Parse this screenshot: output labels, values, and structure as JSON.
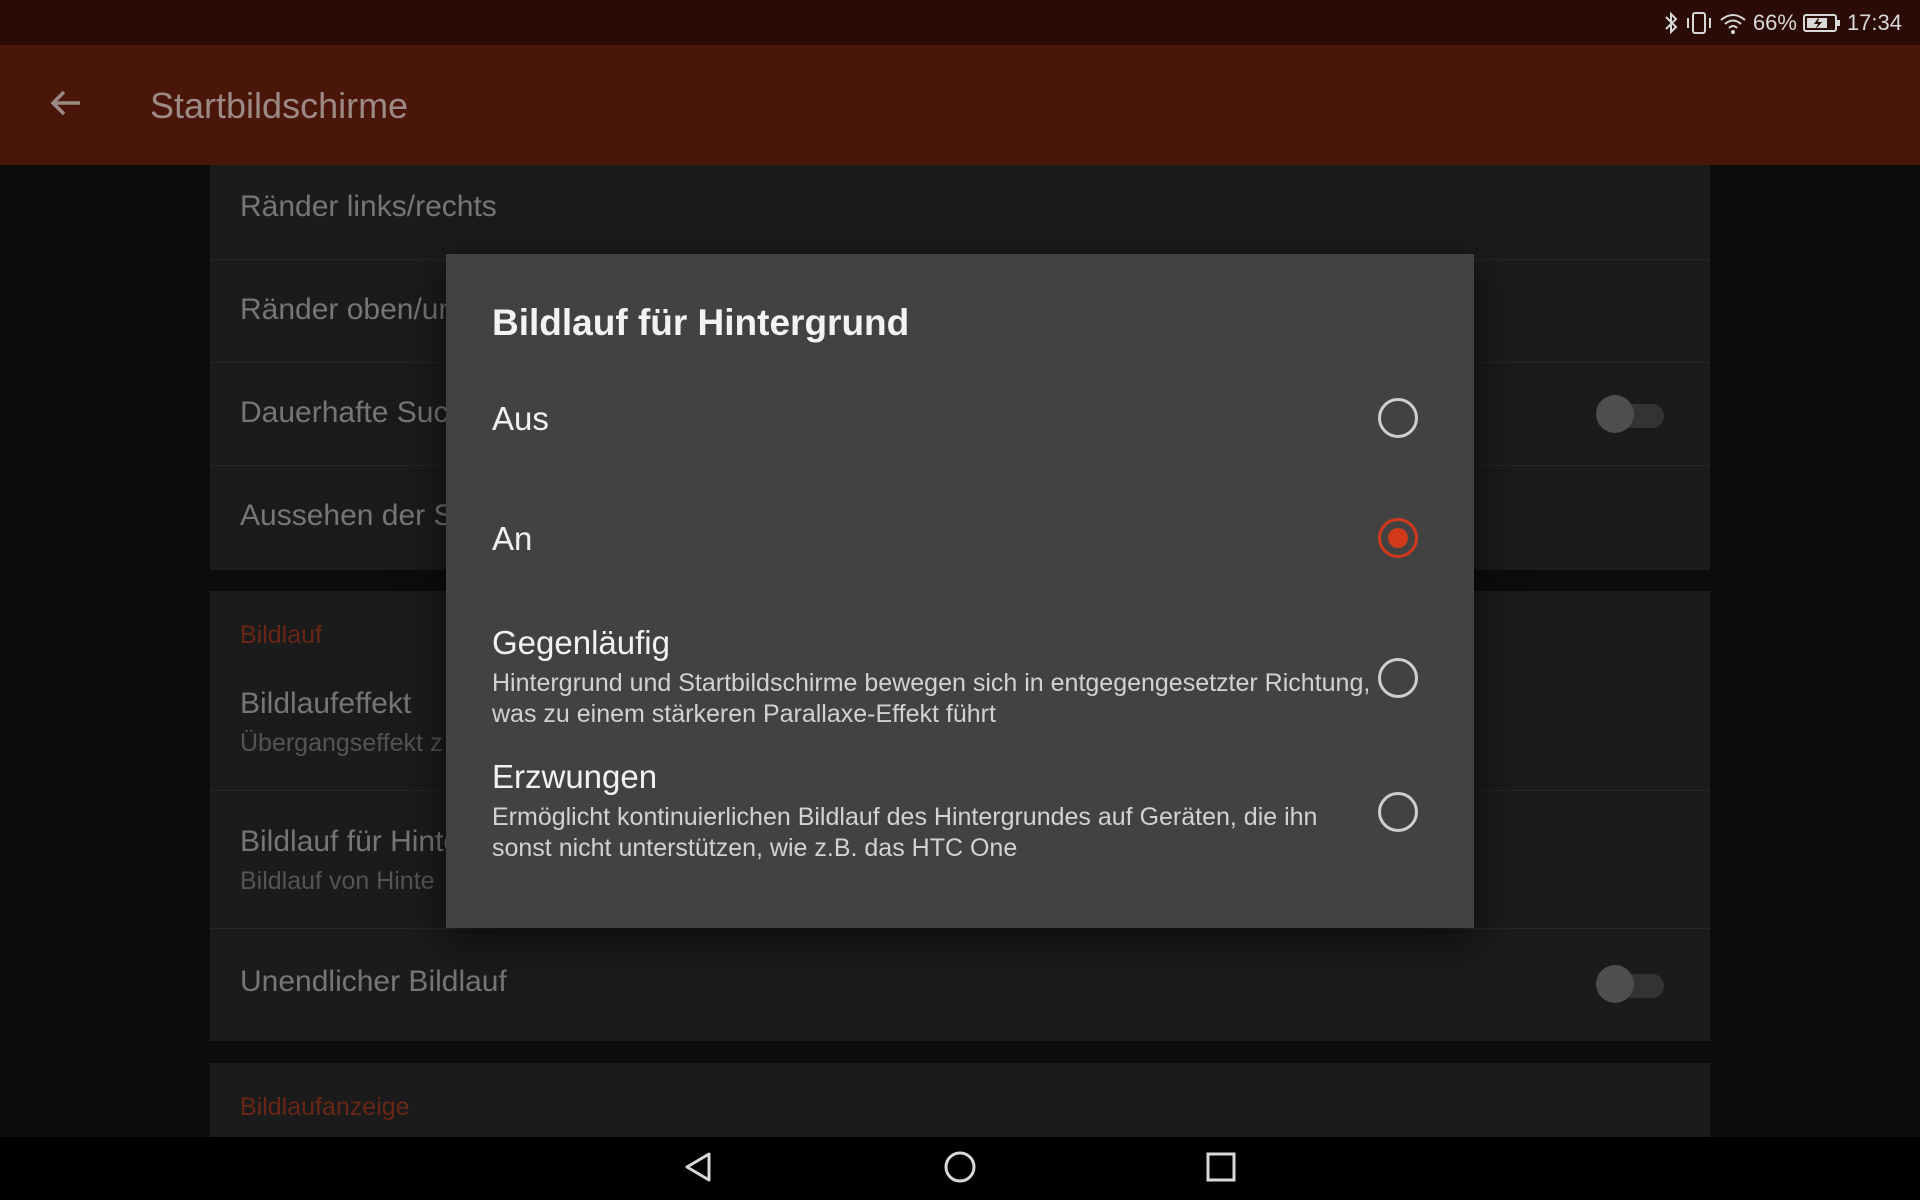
{
  "status_bar": {
    "battery_percent": "66%",
    "time": "17:34",
    "icons": [
      "bluetooth-icon",
      "vibrate-icon",
      "wifi-icon",
      "battery-charging-icon"
    ]
  },
  "app_bar": {
    "back_icon": "arrow-left-icon",
    "title": "Startbildschirme"
  },
  "settings": {
    "card1": {
      "rows": [
        {
          "label": "Ränder links/rechts"
        },
        {
          "label": "Ränder oben/unten"
        },
        {
          "label": "Dauerhafte Suchleiste",
          "toggle": false
        },
        {
          "label": "Aussehen der Suchleiste"
        }
      ]
    },
    "card2": {
      "section_title": "Bildlauf",
      "rows": [
        {
          "label": "Bildlaufeffekt",
          "sub": "Übergangseffekt z"
        },
        {
          "label": "Bildlauf für Hintergrund",
          "sub": "Bildlauf von Hinte"
        },
        {
          "label": "Unendlicher Bildlauf",
          "toggle": false
        }
      ]
    },
    "card3": {
      "section_title": "Bildlaufanzeige"
    }
  },
  "dialog": {
    "title": "Bildlauf für Hintergrund",
    "options": [
      {
        "label": "Aus",
        "description": "",
        "selected": false
      },
      {
        "label": "An",
        "description": "",
        "selected": true
      },
      {
        "label": "Gegenläufig",
        "description": "Hintergrund und Startbildschirme bewegen sich in entgegengesetzter Richtung, was zu einem stärkeren Parallaxe-Effekt führt",
        "selected": false
      },
      {
        "label": "Erzwungen",
        "description": "Ermöglicht kontinuierlichen Bildlauf des Hintergrundes auf Geräten, die ihn sonst nicht unterstützen, wie z.B. das HTC One",
        "selected": false
      }
    ]
  },
  "nav_bar": {
    "buttons": [
      "nav-back-icon",
      "nav-home-icon",
      "nav-recents-icon"
    ]
  },
  "colors": {
    "accent": "#d2391b",
    "app_bar": "#4a160a",
    "dialog_bg": "#424242"
  }
}
